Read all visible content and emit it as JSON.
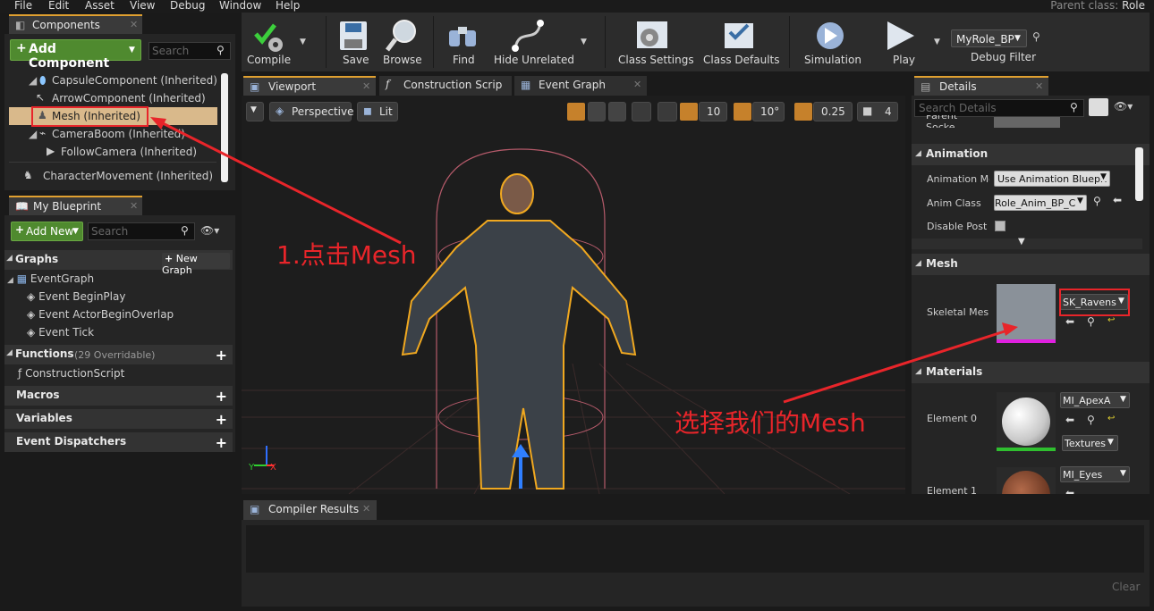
{
  "menu": [
    "File",
    "Edit",
    "Asset",
    "View",
    "Debug",
    "Window",
    "Help"
  ],
  "parent_class": {
    "label": "Parent class:",
    "value": "Role"
  },
  "components": {
    "tab_label": "Components",
    "add_button": "Add Component",
    "search_placeholder": "Search",
    "tree": [
      "CapsuleComponent (Inherited)",
      "ArrowComponent (Inherited)",
      "Mesh (Inherited)",
      "CameraBoom (Inherited)",
      "FollowCamera (Inherited)",
      "CharacterMovement (Inherited)"
    ]
  },
  "my_blueprint": {
    "tab_label": "My Blueprint",
    "add_button": "Add New",
    "search_placeholder": "Search",
    "graphs_label": "Graphs",
    "new_graph": "New Graph",
    "event_graph": "EventGraph",
    "events": [
      "Event BeginPlay",
      "Event ActorBeginOverlap",
      "Event Tick"
    ],
    "functions_label": "Functions",
    "functions_count": "(29 Overridable)",
    "construction_script": "ConstructionScript",
    "macros": "Macros",
    "variables": "Variables",
    "dispatchers": "Event Dispatchers"
  },
  "toolbar": {
    "compile": "Compile",
    "save": "Save",
    "browse": "Browse",
    "find": "Find",
    "hide_unrelated": "Hide Unrelated",
    "class_settings": "Class Settings",
    "class_defaults": "Class Defaults",
    "simulation": "Simulation",
    "play": "Play",
    "debug_object": "MyRole_BP",
    "debug_filter": "Debug Filter"
  },
  "editor_tabs": [
    "Viewport",
    "Construction Scrip",
    "Event Graph"
  ],
  "viewport": {
    "perspective": "Perspective",
    "lit": "Lit",
    "grid_snap": "10",
    "rot_snap": "10°",
    "scale_snap": "0.25",
    "cam_speed": "4"
  },
  "details": {
    "tab_label": "Details",
    "search_placeholder": "Search Details",
    "parent_socket": "Parent Socke",
    "animation_head": "Animation",
    "anim_mode_label": "Animation Mo",
    "anim_mode_value": "Use Animation Bluepri",
    "anim_class_label": "Anim Class",
    "anim_class_value": "Role_Anim_BP_C",
    "disable_post_label": "Disable Post F",
    "mesh_head": "Mesh",
    "skeletal_mesh_label": "Skeletal Mesh",
    "skeletal_mesh_value": "SK_Ravens",
    "materials_head": "Materials",
    "element0_label": "Element 0",
    "element0_value": "MI_ApexA",
    "textures_label": "Textures",
    "element1_label": "Element 1",
    "element1_value": "MI_Eyes"
  },
  "compiler": {
    "tab_label": "Compiler Results",
    "clear": "Clear"
  },
  "annotations": {
    "step1": "1.点击Mesh",
    "step2": "选择我们的Mesh"
  },
  "colors": {
    "accent_orange": "#e0a030",
    "add_green": "#4f8a2f",
    "annotation_red": "#e8252a",
    "selection": "#d9b98b"
  }
}
